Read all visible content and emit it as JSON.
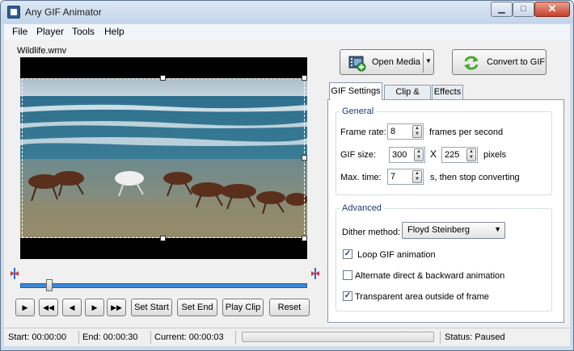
{
  "window": {
    "title": "Any GIF Animator"
  },
  "menu": [
    "File",
    "Player",
    "Tools",
    "Help"
  ],
  "player": {
    "file_name": "Wildlife.wmv",
    "buttons": {
      "set_start": "Set Start",
      "set_end": "Set End",
      "play_clip": "Play Clip",
      "reset": "Reset"
    },
    "position_fraction": 0.09
  },
  "toolbar": {
    "open_media": "Open Media",
    "convert": "Convert to GIF"
  },
  "tabs": [
    "GIF Settings",
    "Clip & Crop",
    "Effects"
  ],
  "general": {
    "title": "General",
    "frame_rate_label": "Frame rate:",
    "frame_rate_value": "8",
    "frame_rate_unit": "frames per second",
    "gif_size_label": "GIF size:",
    "gif_width": "300",
    "gif_x": "X",
    "gif_height": "225",
    "gif_size_unit": "pixels",
    "max_time_label": "Max. time:",
    "max_time_value": "7",
    "max_time_unit": "s, then stop converting"
  },
  "advanced": {
    "title": "Advanced",
    "dither_label": "Dither method:",
    "dither_value": "Floyd Steinberg",
    "loop_label": "Loop GIF animation",
    "loop_checked": true,
    "alternate_label": "Alternate direct & backward animation",
    "alternate_checked": false,
    "transparent_label": "Transparent area outside of frame",
    "transparent_checked": true
  },
  "status": {
    "start": "Start: 00:00:00",
    "end": "End: 00:00:30",
    "current": "Current: 00:00:03",
    "state": "Status: Paused"
  },
  "colors": {
    "accent": "#3c88d8",
    "window_frame": "#cfdcea"
  }
}
